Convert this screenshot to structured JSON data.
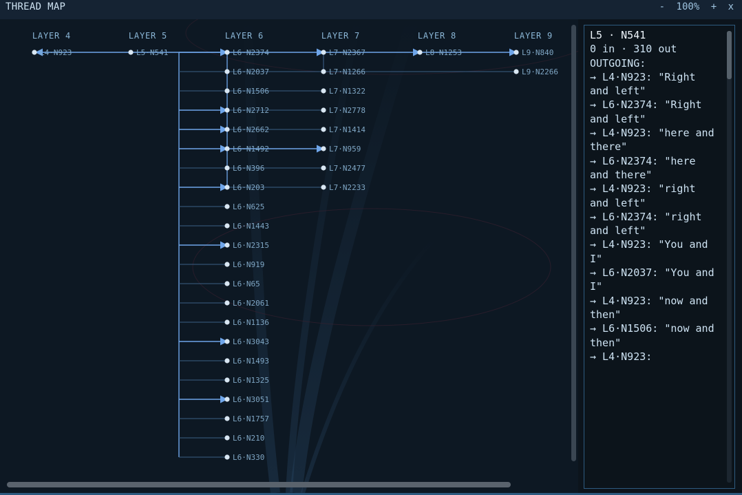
{
  "title": "THREAD MAP",
  "controls": {
    "zoom_out": "-",
    "zoom": "100%",
    "zoom_in": "+",
    "close": "x"
  },
  "layers": [
    "LAYER 4",
    "LAYER 5",
    "LAYER 6",
    "LAYER 7",
    "LAYER 8",
    "LAYER 9"
  ],
  "nodes": {
    "layer4": [
      "L4·N923"
    ],
    "layer5": [
      "L5·N541"
    ],
    "layer6": [
      "L6·N2374",
      "L6·N2037",
      "L6·N1506",
      "L6·N2712",
      "L6·N2662",
      "L6·N1492",
      "L6·N396",
      "L6·N203",
      "L6·N625",
      "L6·N1443",
      "L6·N2315",
      "L6·N919",
      "L6·N65",
      "L6·N2061",
      "L6·N1136",
      "L6·N3043",
      "L6·N1493",
      "L6·N1325",
      "L6·N3051",
      "L6·N1757",
      "L6·N210",
      "L6·N330"
    ],
    "layer7": [
      "L7·N2367",
      "L7·N1266",
      "L7·N1322",
      "L7·N2778",
      "L7·N1414",
      "L7·N959",
      "L7·N2477",
      "L7·N2233"
    ],
    "layer8": [
      "L8·N1253"
    ],
    "layer9": [
      "L9·N840",
      "L9·N2266"
    ]
  },
  "highlighted_l6_links": [
    "L6·N2374",
    "L6·N2712",
    "L6·N2662",
    "L6·N1492",
    "L6·N203",
    "L6·N2315",
    "L6·N3043",
    "L6·N3051"
  ],
  "panel": {
    "title": "L5 · N541",
    "stats": "0 in · 310 out",
    "section": "OUTGOING:",
    "lines": [
      "→ L4·N923: \"Right and left\"",
      "→ L6·N2374: \"Right and left\"",
      "→ L4·N923: \"here and there\"",
      "→ L6·N2374: \"here and there\"",
      "→ L4·N923: \"right and left\"",
      "→ L6·N2374: \"right and left\"",
      "→ L4·N923: \"You and I\"",
      "→ L6·N2037: \"You and I\"",
      "→ L4·N923: \"now and then\"",
      "→ L6·N1506: \"now and then\"",
      "→ L4·N923:"
    ]
  },
  "colors": {
    "accent": "#6fa6ea",
    "link_dim": "#3c5f86",
    "node": "#d8e6f2"
  }
}
